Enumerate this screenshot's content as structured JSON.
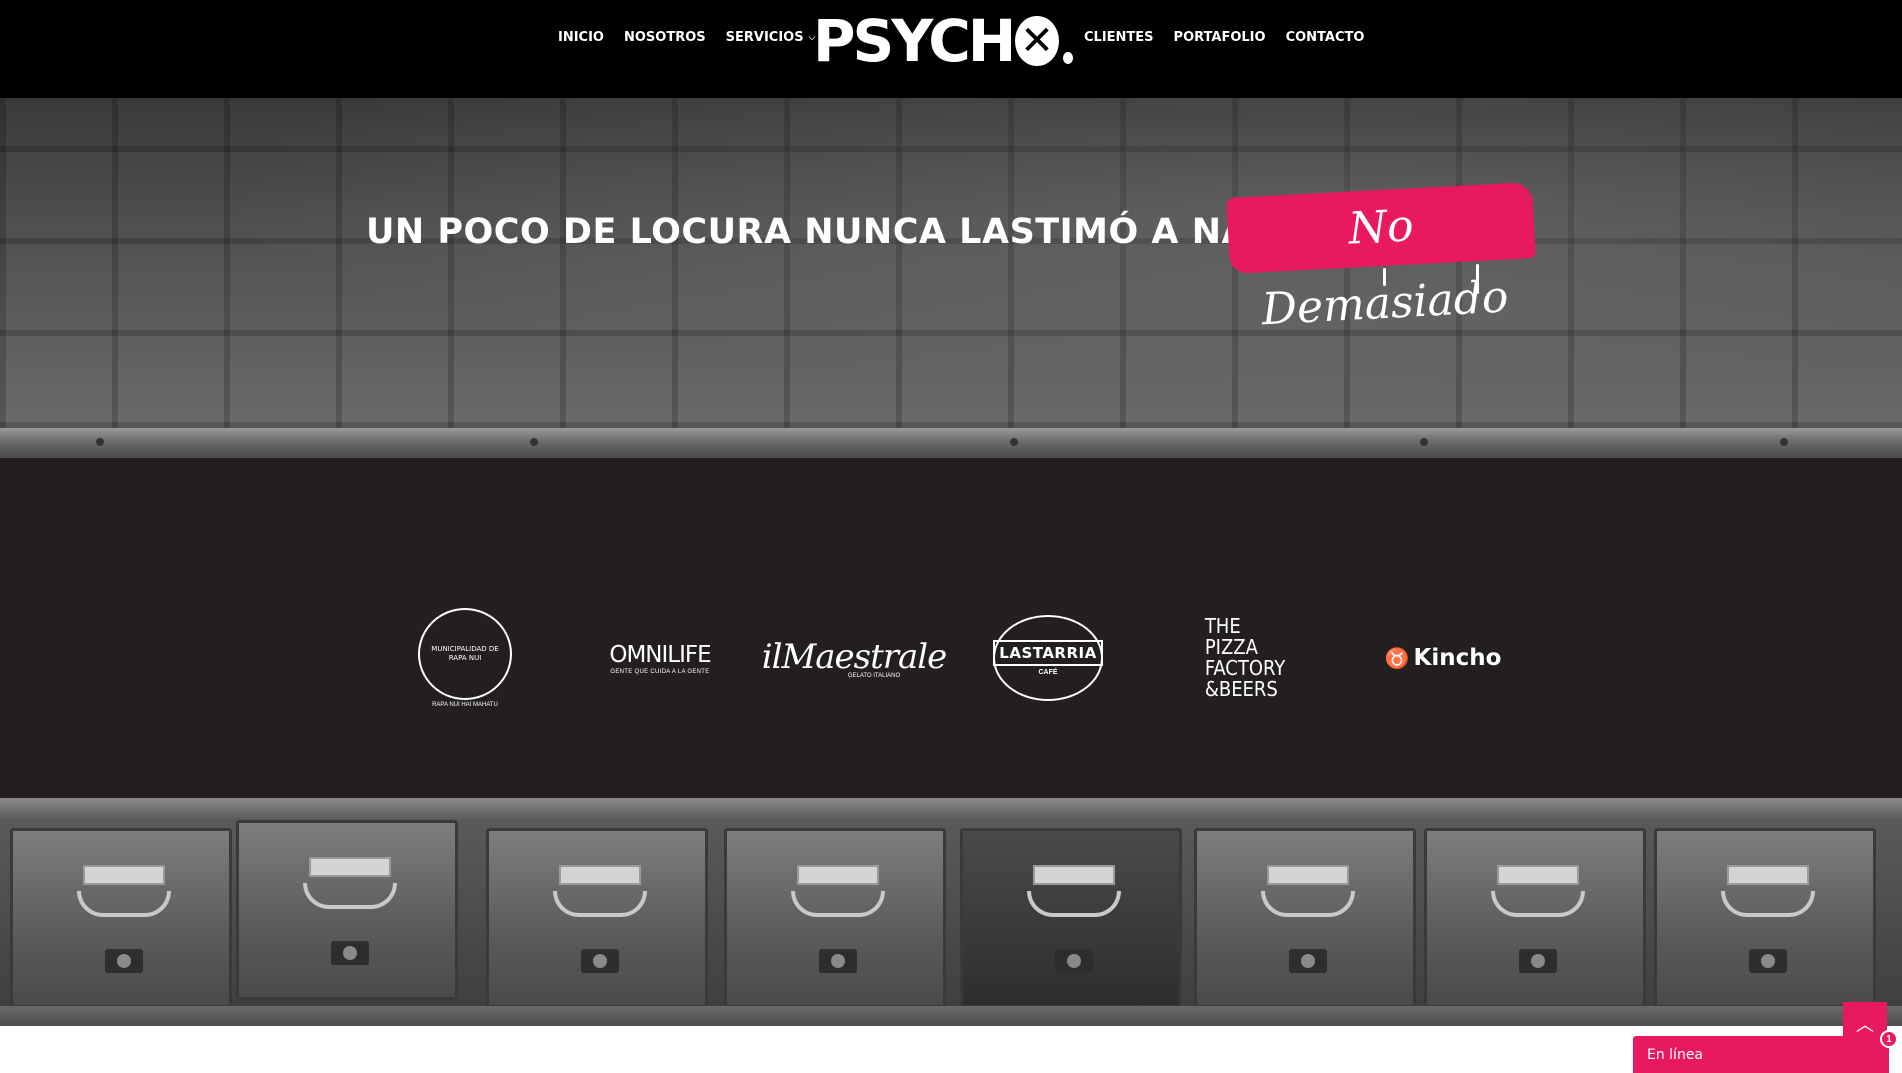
{
  "header": {
    "nav_left": [
      {
        "label": "INICIO"
      },
      {
        "label": "NOSOTROS"
      },
      {
        "label": "SERVICIOS"
      }
    ],
    "nav_right": [
      {
        "label": "CLIENTES"
      },
      {
        "label": "PORTAFOLIO"
      },
      {
        "label": "CONTACTO"
      }
    ],
    "logo_text": "PSYCH",
    "logo_x": "✕"
  },
  "hero": {
    "tagline": "UN POCO DE LOCURA NUNCA LASTIMÓ A NADIE...",
    "stamp": "No Demasiado"
  },
  "clients": [
    {
      "name": "MUNICIPALIDAD DE RAPA NUI",
      "subtitle": "RAPA NUI HAI MAHATU"
    },
    {
      "name": "OMNILIFE",
      "subtitle": "GENTE QUE CUIDA A LA GENTE"
    },
    {
      "name": "ilMaestrale",
      "subtitle": "GELATO ITALIANO"
    },
    {
      "name": "LASTARRIA",
      "subtitle": "CAFÉ"
    },
    {
      "name": "THE PIZZA\nFACTORY\n&BEERS",
      "subtitle": ""
    },
    {
      "name": "Kincho",
      "subtitle": ""
    }
  ],
  "chat": {
    "label": "En línea",
    "badge": "1"
  },
  "colors": {
    "accent": "#e8195c",
    "header_bg": "#000000",
    "clients_bg": "#231f20"
  },
  "icons": {
    "scroll_top": "chevron-up-icon",
    "servicios_dropdown": "chevron-down-icon"
  }
}
